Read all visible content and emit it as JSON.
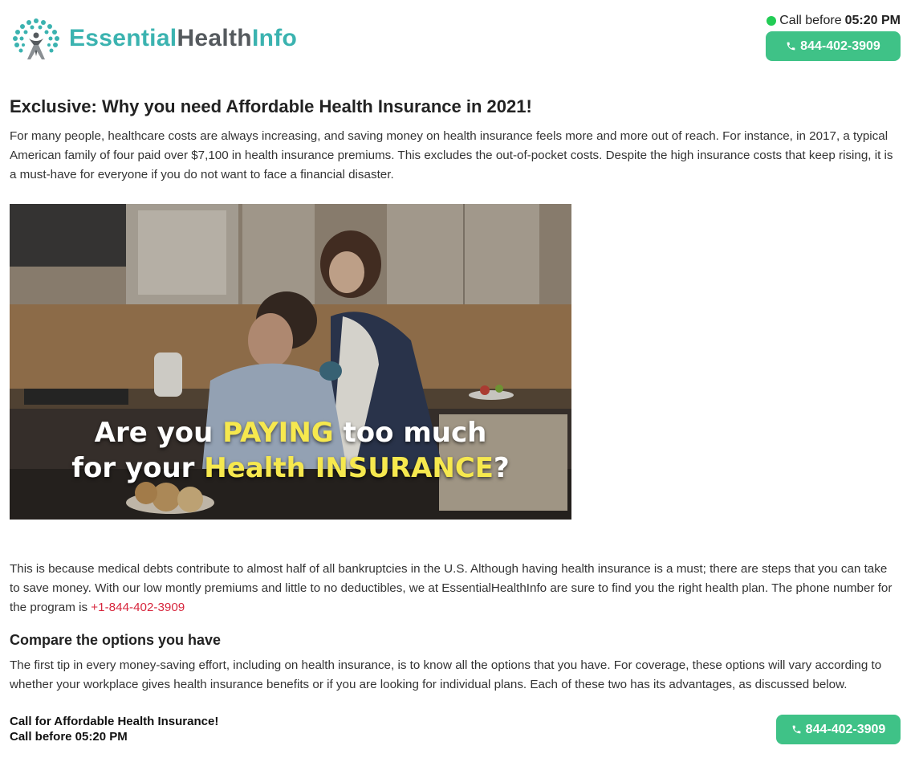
{
  "header": {
    "logo_text_part1": "Essential",
    "logo_text_part2": "Health",
    "logo_text_part3": "Info",
    "call_status_prefix": "Call before",
    "call_time": "05:20 PM",
    "phone_button_label": "844-402-3909"
  },
  "article": {
    "title": "Exclusive: Why you need Affordable Health Insurance in 2021!",
    "paragraph1": "For many people, healthcare costs are always increasing, and saving money on health insurance feels more and more out of reach. For instance, in 2017, a typical American family of four paid over $7,100 in health insurance premiums. This excludes the out-of-pocket costs. Despite the high insurance costs that keep rising, it is a must-have for everyone if you do not want to face a financial disaster.",
    "hero_line1_a": "Are you ",
    "hero_line1_b": "PAYING",
    "hero_line1_c": " too much",
    "hero_line2_a": "for your ",
    "hero_line2_b": "Health INSURANCE",
    "hero_line2_c": "?",
    "paragraph2": "This is because medical debts contribute to almost half of all bankruptcies in the U.S. Although having health insurance is a must; there are steps that you can take to save money. With our low montly premiums and little to no deductibles, we at EssentialHealthInfo are sure to find you the right health plan. The phone number for the program is ",
    "paragraph2_link": "+1-844-402-3909",
    "subheading": "Compare the options you have",
    "paragraph3": "The first tip in every money-saving effort, including on health insurance, is to know all the options that you have. For coverage, these options will vary according to whether your workplace gives health insurance benefits or if you are looking for individual plans. Each of these two has its advantages, as discussed below."
  },
  "footer": {
    "line1": "Call for Affordable Health Insurance!",
    "line2": "Call before 05:20 PM",
    "phone_button_label": "844-402-3909"
  },
  "colors": {
    "brand_teal": "#3bb3b0",
    "brand_grey": "#555a5e",
    "button_green": "#3fc287",
    "status_green": "#22cc55",
    "link_red": "#d7263d",
    "hero_highlight": "#f6e84e"
  }
}
